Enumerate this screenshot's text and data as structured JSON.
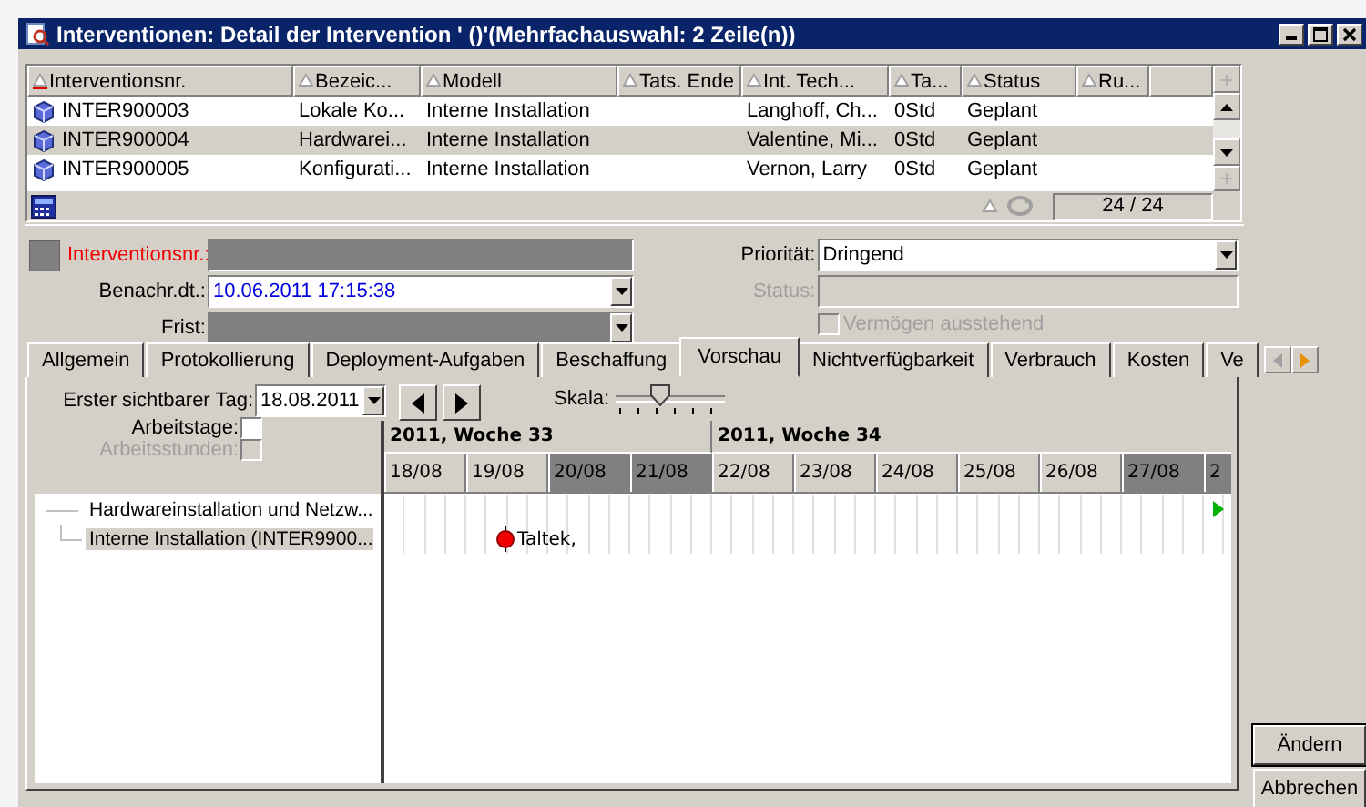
{
  "window": {
    "title": "Interventionen: Detail der Intervention ' ()'(Mehrfachauswahl: 2 Zeile(n))"
  },
  "list": {
    "columns": [
      {
        "label": "Interventionsnr.",
        "sorted": true
      },
      {
        "label": "Bezeic...",
        "sorted": false
      },
      {
        "label": "Modell",
        "sorted": false
      },
      {
        "label": "Tats. Ende",
        "sorted": false
      },
      {
        "label": "Int. Tech...",
        "sorted": false
      },
      {
        "label": "Ta...",
        "sorted": false
      },
      {
        "label": "Status",
        "sorted": false
      },
      {
        "label": "Ru...",
        "sorted": false
      }
    ],
    "rows": [
      {
        "cells": [
          "INTER900003",
          "Lokale Ko...",
          "Interne Installation",
          "",
          "Langhoff, Ch...",
          "0Std",
          "Geplant",
          ""
        ],
        "selected": false
      },
      {
        "cells": [
          "INTER900004",
          "Hardwarei...",
          "Interne Installation",
          "",
          "Valentine, Mi...",
          "0Std",
          "Geplant",
          ""
        ],
        "selected": true
      },
      {
        "cells": [
          "INTER900005",
          "Konfigurati...",
          "Interne Installation",
          "",
          "Vernon, Larry",
          "0Std",
          "Geplant",
          ""
        ],
        "selected": false
      }
    ],
    "counter": "24 / 24"
  },
  "form": {
    "left": [
      {
        "label": "Interventionsnr.:",
        "kind": "readonly",
        "required": true,
        "dropdown": false
      },
      {
        "label": "Benachr.dt.:",
        "value": "10.06.2011 17:15:38",
        "kind": "editable",
        "required": false,
        "dropdown": true
      },
      {
        "label": "Frist:",
        "kind": "readonly",
        "required": false,
        "dropdown": true
      }
    ],
    "right": [
      {
        "label": "Priorität:",
        "value": "Dringend",
        "kind": "editable",
        "required": false,
        "dropdown": true
      },
      {
        "label": "Status:",
        "kind": "disabled",
        "required": false,
        "dropdown": false
      }
    ],
    "checkbox": {
      "label": "Vermögen ausstehend",
      "checked": false,
      "disabled": true
    }
  },
  "tabs": [
    {
      "label": "Allgemein",
      "selected": false
    },
    {
      "label": "Protokollierung",
      "selected": false
    },
    {
      "label": "Deployment-Aufgaben",
      "selected": false
    },
    {
      "label": "Beschaffung",
      "selected": false
    },
    {
      "label": "Vorschau",
      "selected": true
    },
    {
      "label": "Nichtverfügbarkeit",
      "selected": false
    },
    {
      "label": "Verbrauch",
      "selected": false
    },
    {
      "label": "Kosten",
      "selected": false
    },
    {
      "label": "Ve",
      "selected": false
    }
  ],
  "schedule": {
    "first_day": {
      "label": "Erster sichtbarer Tag:",
      "value": "18.08.2011"
    },
    "scale": {
      "label": "Skala:",
      "level": 0.4
    },
    "options": [
      {
        "label": "Arbeitstage:",
        "checked": false,
        "disabled": false
      },
      {
        "label": "Arbeitsstunden:",
        "checked": false,
        "disabled": true
      }
    ],
    "weeks": [
      {
        "label": "2011, Woche 33",
        "days": [
          {
            "label": "18/08",
            "weekend": false
          },
          {
            "label": "19/08",
            "weekend": false
          },
          {
            "label": "20/08",
            "weekend": true
          },
          {
            "label": "21/08",
            "weekend": true
          }
        ]
      },
      {
        "label": "2011, Woche 34",
        "days": [
          {
            "label": "22/08",
            "weekend": false
          },
          {
            "label": "23/08",
            "weekend": false
          },
          {
            "label": "24/08",
            "weekend": false
          },
          {
            "label": "25/08",
            "weekend": false
          },
          {
            "label": "26/08",
            "weekend": false
          },
          {
            "label": "27/08",
            "weekend": true
          },
          {
            "label": "2",
            "weekend": true
          }
        ]
      }
    ],
    "tree": [
      {
        "label": "Hardwareinstallation und Netzw...",
        "selected": false,
        "continues": true
      },
      {
        "label": "Interne Installation (INTER9900...",
        "selected": true,
        "continues": false,
        "marker": "Taltek,"
      }
    ]
  },
  "buttons": [
    {
      "label": "Ändern",
      "default": true
    },
    {
      "label": "Abbrechen",
      "default": false
    }
  ]
}
